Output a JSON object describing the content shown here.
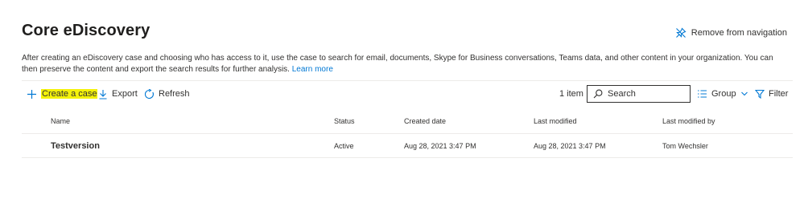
{
  "page": {
    "title": "Core eDiscovery",
    "remove_nav_label": "Remove from navigation",
    "description": "After creating an eDiscovery case and choosing who has access to it, use the case to search for email, documents, Skype for Business conversations, Teams data, and other content in your organization. You can then preserve the content and export the search results for further analysis.",
    "learn_more": "Learn more"
  },
  "toolbar": {
    "create_label": "Create a case",
    "export_label": "Export",
    "refresh_label": "Refresh",
    "item_count": "1 item",
    "search_placeholder": "Search",
    "group_label": "Group",
    "filter_label": "Filter"
  },
  "table": {
    "columns": [
      "Name",
      "Status",
      "Created date",
      "Last modified",
      "Last modified by"
    ],
    "rows": [
      [
        "Testversion",
        "Active",
        "Aug 28, 2021 3:47 PM",
        "Aug 28, 2021 3:47 PM",
        "Tom Wechsler"
      ]
    ]
  },
  "colors": {
    "accent": "#0078d4",
    "highlight": "#f4f20a",
    "text": "#323130"
  },
  "icons": [
    "pin-off-icon",
    "plus-icon",
    "download-icon",
    "refresh-icon",
    "search-icon",
    "group-list-icon",
    "chevron-down-icon",
    "filter-icon"
  ]
}
